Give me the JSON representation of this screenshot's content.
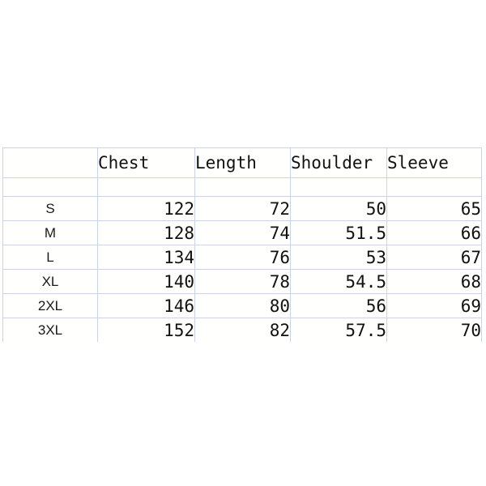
{
  "page": {
    "background_color": "#ffffff",
    "border_color": "#ccd2e8",
    "text_color": "#111111"
  },
  "size_chart": {
    "columns": [
      {
        "key": "size",
        "label": ""
      },
      {
        "key": "chest",
        "label": "Chest"
      },
      {
        "key": "length",
        "label": "Length"
      },
      {
        "key": "shoulder",
        "label": "Shoulder"
      },
      {
        "key": "sleeve",
        "label": "Sleeve"
      }
    ],
    "rows": [
      {
        "size": "S",
        "chest": "122",
        "length": "72",
        "shoulder": "50",
        "sleeve": "65"
      },
      {
        "size": "M",
        "chest": "128",
        "length": "74",
        "shoulder": "51.5",
        "sleeve": "66"
      },
      {
        "size": "L",
        "chest": "134",
        "length": "76",
        "shoulder": "53",
        "sleeve": "67"
      },
      {
        "size": "XL",
        "chest": "140",
        "length": "78",
        "shoulder": "54.5",
        "sleeve": "68"
      },
      {
        "size": "2XL",
        "chest": "146",
        "length": "80",
        "shoulder": "56",
        "sleeve": "69"
      },
      {
        "size": "3XL",
        "chest": "152",
        "length": "82",
        "shoulder": "57.5",
        "sleeve": "70"
      }
    ]
  }
}
